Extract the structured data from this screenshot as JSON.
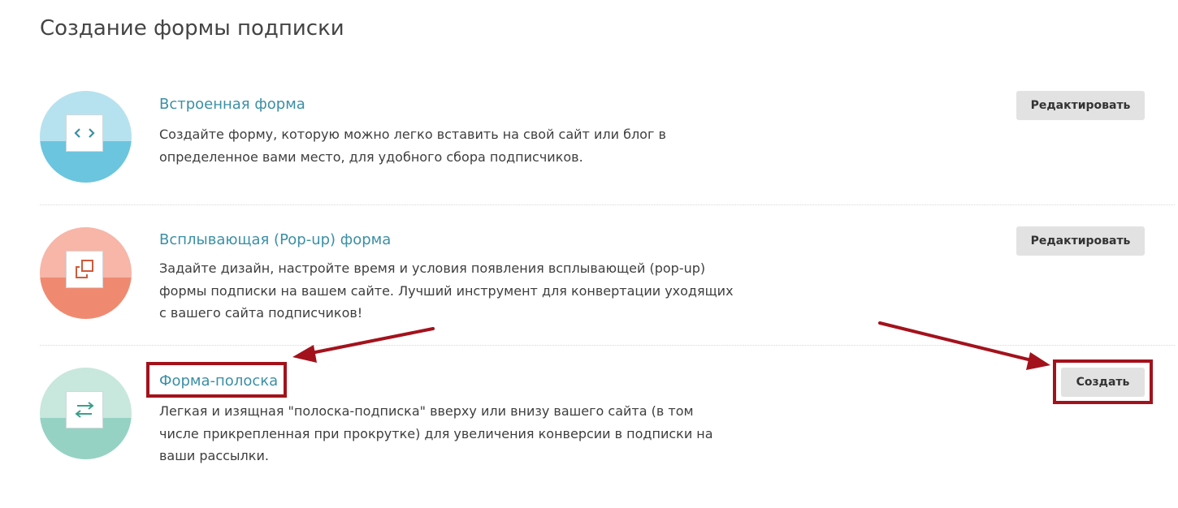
{
  "page": {
    "title": "Создание формы подписки"
  },
  "items": [
    {
      "title": "Встроенная форма",
      "description": "Создайте форму, которую можно легко вставить на свой сайт или блог в определенное вами место, для удобного сбора подписчиков.",
      "button_label": "Редактировать",
      "icon": "code-brackets-icon"
    },
    {
      "title": "Всплывающая (Pop-up) форма",
      "description": "Задайте дизайн, настройте время и условия появления всплывающей (pop-up) формы подписки на вашем сайте. Лучший инструмент для конвертации уходящих с вашего сайта подписчиков!",
      "button_label": "Редактировать",
      "icon": "popup-windows-icon"
    },
    {
      "title": "Форма-полоска",
      "description": "Легкая и изящная \"полоска-подписка\" вверху или внизу вашего сайта (в том числе прикрепленная при прокрутке) для увеличения конверсии в подписки на ваши рассылки.",
      "button_label": "Создать",
      "icon": "swap-arrows-icon"
    }
  ],
  "colors": {
    "link": "#3b8fa5",
    "annotation": "#a3121c",
    "button_bg": "#e2e2e2"
  }
}
